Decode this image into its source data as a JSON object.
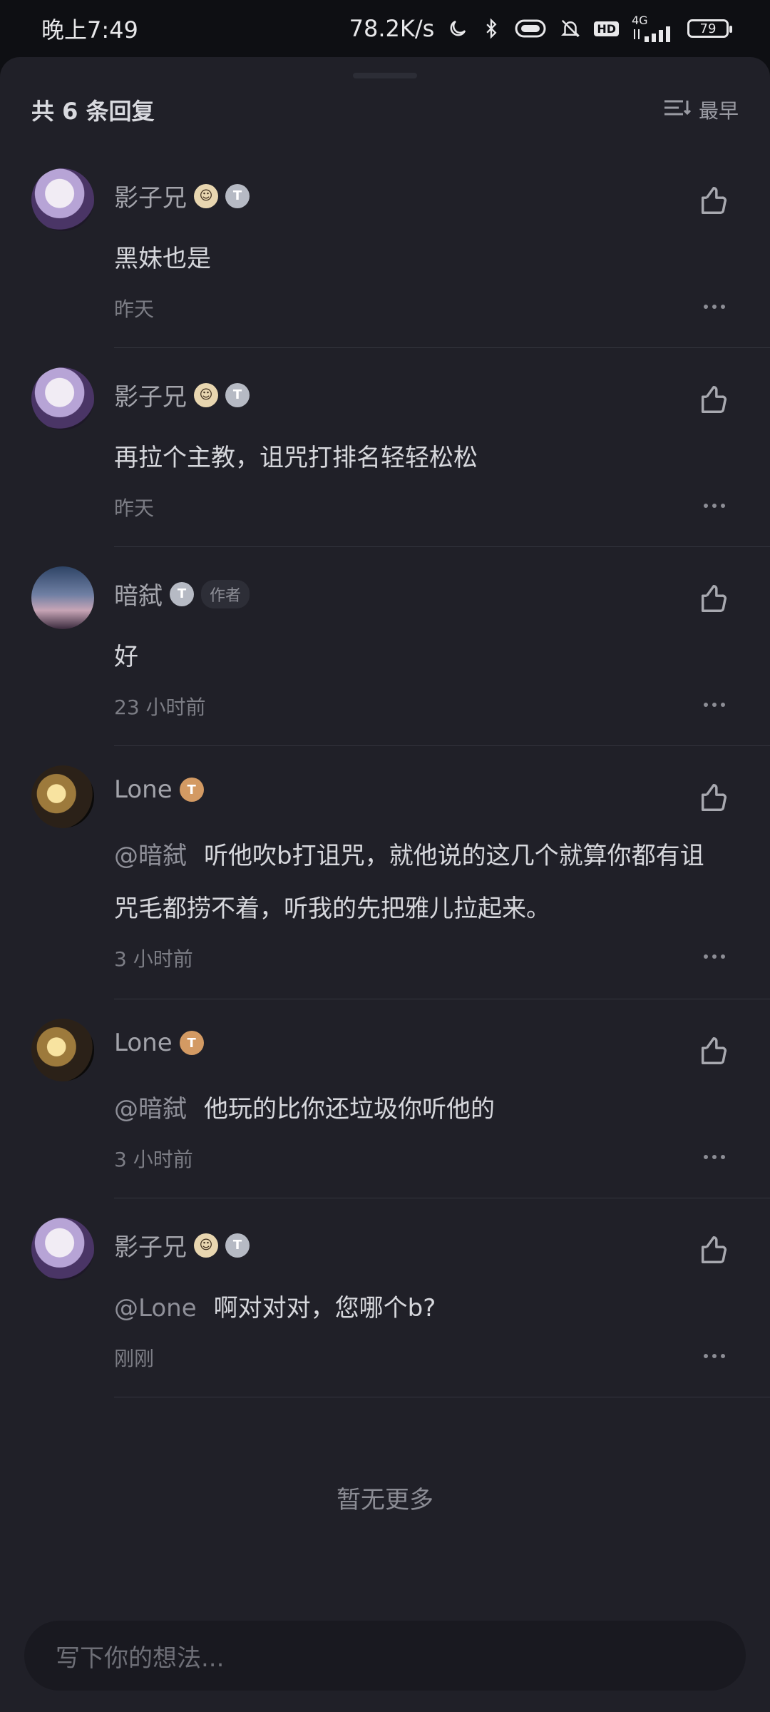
{
  "status_bar": {
    "time": "晚上7:49",
    "network_speed": "78.2K/s",
    "battery": "79",
    "hd_label": "HD",
    "signal_label": "4G"
  },
  "header": {
    "reply_count": "共 6 条回复",
    "sort_label": "最早"
  },
  "comments": [
    {
      "username": "影子兄",
      "text": "黑妹也是",
      "time": "昨天"
    },
    {
      "username": "影子兄",
      "text": "再拉个主教，诅咒打排名轻轻松松",
      "time": "昨天"
    },
    {
      "username": "暗弑",
      "author_tag": "作者",
      "text": "好",
      "time": "23 小时前"
    },
    {
      "username": "Lone",
      "mention": "@暗弑",
      "text": "听他吹b打诅咒，就他说的这几个就算你都有诅咒毛都捞不着，听我的先把雅儿拉起来。",
      "time": "3 小时前"
    },
    {
      "username": "Lone",
      "mention": "@暗弑",
      "text": "他玩的比你还垃圾你听他的",
      "time": "3 小时前"
    },
    {
      "username": "影子兄",
      "mention": "@Lone",
      "text": "啊对对对，您哪个b?",
      "time": "刚刚"
    }
  ],
  "footer": {
    "no_more": "暂无更多",
    "input_placeholder": "写下你的想法..."
  }
}
